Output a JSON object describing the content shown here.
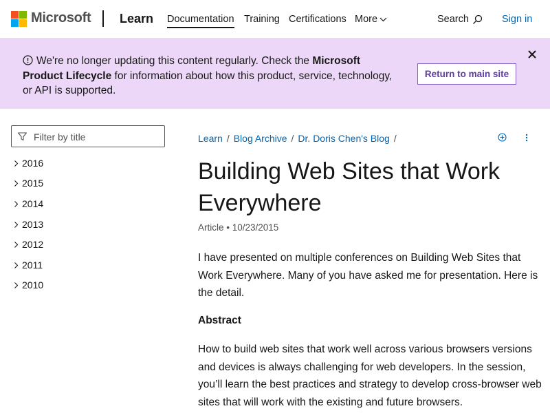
{
  "header": {
    "brand": "Microsoft",
    "product": "Learn",
    "nav": {
      "documentation": "Documentation",
      "training": "Training",
      "certifications": "Certifications",
      "more": "More"
    },
    "search_label": "Search",
    "signin_label": "Sign in"
  },
  "banner": {
    "text_before": "We're no longer updating this content regularly. Check the ",
    "link_text": "Microsoft Product Lifecycle",
    "text_after": " for information about how this product, service, technology, or API is supported.",
    "button_label": "Return to main site"
  },
  "sidebar": {
    "filter_placeholder": "Filter by title",
    "items": [
      "2016",
      "2015",
      "2014",
      "2013",
      "2012",
      "2011",
      "2010"
    ]
  },
  "breadcrumb": {
    "items": [
      "Learn",
      "Blog Archive",
      "Dr. Doris Chen's Blog"
    ]
  },
  "article": {
    "title": "Building Web Sites that Work Everywhere",
    "type": "Article",
    "date": "10/23/2015",
    "intro": "I have presented on multiple conferences on Building Web Sites that Work Everywhere.  Many of you have asked me for presentation.  Here is the detail.",
    "abstract_heading": "Abstract",
    "abstract_text": "How to build web sites that work well across various browsers versions and devices is always challenging for web developers. In the session, you’ll learn the best practices and strategy to develop cross-browser web sites that will work with the existing and future browsers."
  },
  "icons": {
    "info": "info-circle-icon",
    "close": "close-icon",
    "filter": "filter-icon",
    "search": "search-icon",
    "add": "add-collection-icon",
    "more": "more-vertical-icon",
    "chevron": "chevron-right-icon"
  },
  "colors": {
    "banner_bg": "#ecd7f8",
    "link": "#0065b3",
    "button_text": "#5e3ba0",
    "button_border": "#8661c5"
  }
}
